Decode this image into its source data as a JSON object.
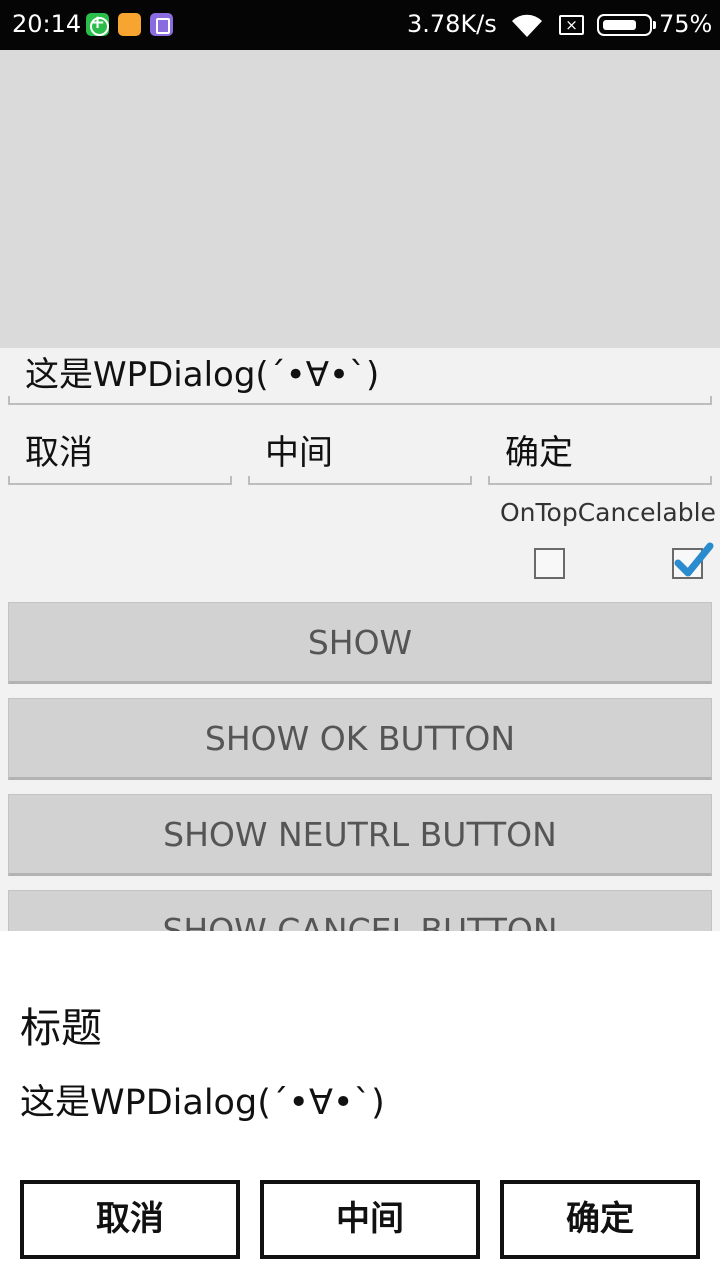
{
  "status_bar": {
    "time": "20:14",
    "net_speed": "3.78K/s",
    "battery": "75%",
    "battery_level": 0.75,
    "sim_glyph": "×",
    "icons": [
      "app-green-plus-icon",
      "app-orange-icon",
      "app-purple-icon",
      "wifi-icon",
      "no-sim-icon",
      "battery-icon"
    ]
  },
  "form": {
    "message_value": "这是WPDialog(´•∀•`)",
    "cancel_value": "取消",
    "neutral_value": "中间",
    "ok_value": "确定",
    "checkbox_label": "OnTopCancelable",
    "ontop_checked": false,
    "cancelable_checked": true
  },
  "buttons": {
    "show": "SHOW",
    "show_ok": "SHOW OK BUTTON",
    "show_neutral": "SHOW NEUTRL BUTTON",
    "show_cancel": "SHOW CANCEL BUTTON"
  },
  "dialog": {
    "title": "标题",
    "message": "这是WPDialog(´•∀•`)",
    "cancel_label": "取消",
    "neutral_label": "中间",
    "ok_label": "确定"
  },
  "colors": {
    "accent_check": "#2a8ccf",
    "dialog_border": "#111111",
    "button_bg": "#d2d2d2"
  }
}
